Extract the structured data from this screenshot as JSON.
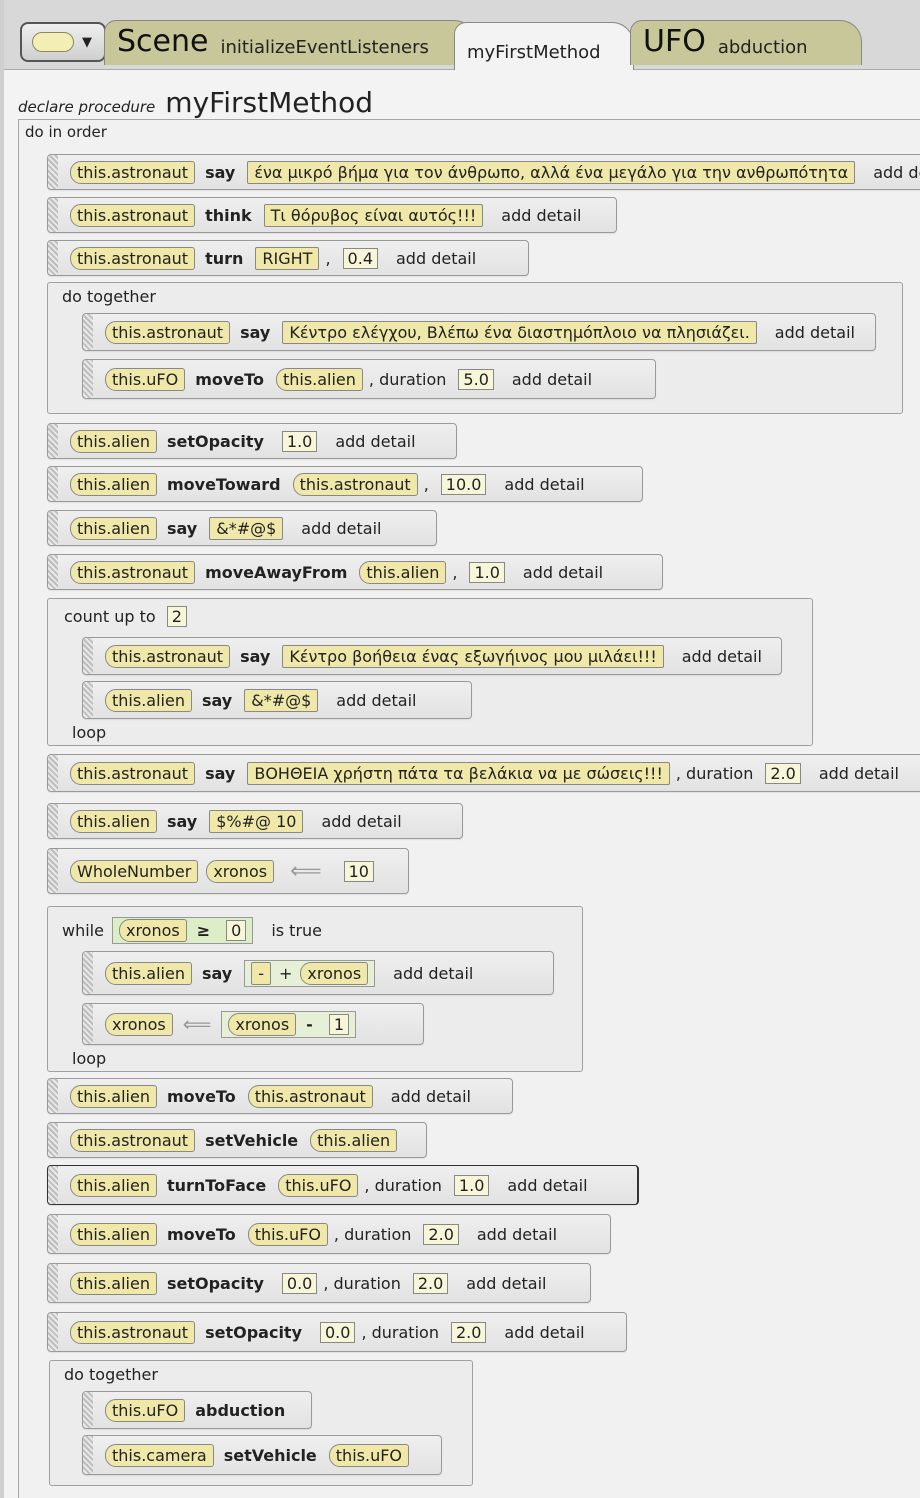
{
  "tabs": {
    "scene_label": "Scene",
    "scene_methods": [
      "initializeEventListeners",
      "myFirstMethod"
    ],
    "ufo_label": "UFO",
    "ufo_methods": [
      "abduction"
    ]
  },
  "declaration": {
    "keyword": "declare procedure",
    "name": "myFirstMethod"
  },
  "do_in_order_label": "do in order",
  "statements": {
    "s1": {
      "target": "this.astronaut",
      "method": "say",
      "arg": "ένα μικρό βήμα για τον άνθρωπο, αλλά ένα μεγάλο για την ανθρωπότητα",
      "detail": "add detail"
    },
    "s2": {
      "target": "this.astronaut",
      "method": "think",
      "arg": "Τι θόρυβος είναι αυτός!!!",
      "detail": "add detail"
    },
    "s3": {
      "target": "this.astronaut",
      "method": "turn",
      "arg": "RIGHT",
      "sep": ",",
      "arg2": "0.4",
      "detail": "add detail"
    },
    "dt1": {
      "label": "do together"
    },
    "s4": {
      "target": "this.astronaut",
      "method": "say",
      "arg": "Κέντρο ελέγχου, Βλέπω ένα διαστημόπλοιο να πλησιάζει.",
      "detail": "add detail"
    },
    "s5": {
      "target": "this.uFO",
      "method": "moveTo",
      "arg": "this.alien",
      "kw": ", duration",
      "arg2": "5.0",
      "detail": "add detail"
    },
    "s6": {
      "target": "this.alien",
      "method": "setOpacity",
      "arg": "1.0",
      "detail": "add detail"
    },
    "s7": {
      "target": "this.alien",
      "method": "moveToward",
      "arg": "this.astronaut",
      "sep": ",",
      "arg2": "10.0",
      "detail": "add detail"
    },
    "s8": {
      "target": "this.alien",
      "method": "say",
      "arg": "&*#@$",
      "detail": "add detail"
    },
    "s9": {
      "target": "this.astronaut",
      "method": "moveAwayFrom",
      "arg": "this.alien",
      "sep": ",",
      "arg2": "1.0",
      "detail": "add detail"
    },
    "count": {
      "label": "count up to",
      "value": "2",
      "loop": "loop"
    },
    "s10": {
      "target": "this.astronaut",
      "method": "say",
      "arg": "Κέντρο βοήθεια ένας εξωγήινος μου μιλάει!!!",
      "detail": "add detail"
    },
    "s11": {
      "target": "this.alien",
      "method": "say",
      "arg": "&*#@$",
      "detail": "add detail"
    },
    "s12": {
      "target": "this.astronaut",
      "method": "say",
      "arg": "ΒΟΗΘΕΙΑ χρήστη πάτα τα βελάκια να με σώσεις!!!",
      "kw": ", duration",
      "arg2": "2.0",
      "detail": "add detail"
    },
    "s13": {
      "target": "this.alien",
      "method": "say",
      "arg": "$%#@ 10",
      "detail": "add detail"
    },
    "var": {
      "type": "WholeNumber",
      "name": "xronos",
      "value": "10"
    },
    "while": {
      "label": "while",
      "var": "xronos",
      "op": "≥",
      "value": "0",
      "tail": "is true",
      "loop": "loop"
    },
    "s14": {
      "target": "this.alien",
      "method": "say",
      "arg": "-",
      "op": "+",
      "arg2": "xronos",
      "detail": "add detail"
    },
    "assign": {
      "var": "xronos",
      "rhs_var": "xronos",
      "op": "-",
      "value": "1"
    },
    "s15": {
      "target": "this.alien",
      "method": "moveTo",
      "arg": "this.astronaut",
      "detail": "add detail"
    },
    "s16": {
      "target": "this.astronaut",
      "method": "setVehicle",
      "arg": "this.alien"
    },
    "s17": {
      "target": "this.alien",
      "method": "turnToFace",
      "arg": "this.uFO",
      "kw": ", duration",
      "arg2": "1.0",
      "detail": "add detail"
    },
    "s18": {
      "target": "this.alien",
      "method": "moveTo",
      "arg": "this.uFO",
      "kw": ", duration",
      "arg2": "2.0",
      "detail": "add detail"
    },
    "s19": {
      "target": "this.alien",
      "method": "setOpacity",
      "arg": "0.0",
      "kw": ", duration",
      "arg2": "2.0",
      "detail": "add detail"
    },
    "s20": {
      "target": "this.astronaut",
      "method": "setOpacity",
      "arg": "0.0",
      "kw": ", duration",
      "arg2": "2.0",
      "detail": "add detail"
    },
    "dt2": {
      "label": "do together"
    },
    "s21": {
      "target": "this.uFO",
      "method": "abduction"
    },
    "s22": {
      "target": "this.camera",
      "method": "setVehicle",
      "arg": "this.uFO"
    }
  },
  "colors": {
    "selector_fill": "#efe8a8",
    "tab_olive": "#c8c79a",
    "background": "#f3f3f3"
  }
}
